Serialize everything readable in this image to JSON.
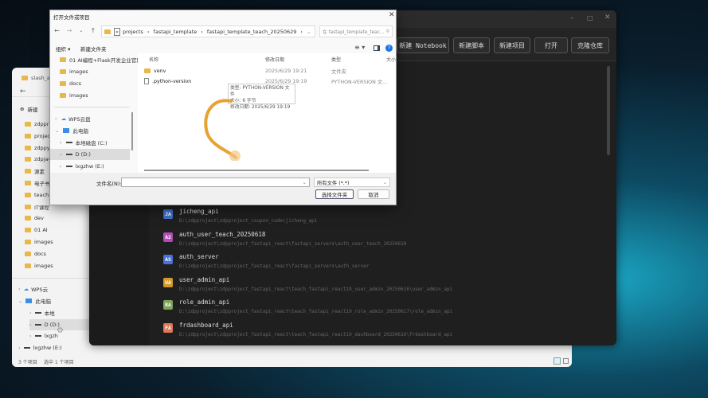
{
  "explorer": {
    "tab": "slash_ad",
    "new_label": "新建",
    "folders": [
      "zdppr",
      "projec",
      "zdppy",
      "zdpjav",
      "源素",
      "电子书",
      "teach",
      "IT课程",
      "dev",
      "01 AI",
      "images",
      "docs",
      "images"
    ],
    "tree": [
      {
        "label": "WPS云",
        "icon": "cloud"
      },
      {
        "label": "此电脑",
        "icon": "pc"
      },
      {
        "label": "本地",
        "icon": "drive"
      },
      {
        "label": "D (D:)",
        "icon": "drive"
      },
      {
        "label": "lxgzh",
        "icon": "drive"
      },
      {
        "label": "lxgzhw (E:)",
        "icon": "drive"
      }
    ],
    "status_items": "3 个项目",
    "status_selected": "选中 1 个项目"
  },
  "app": {
    "toolbar": [
      "新建 Notebook",
      "新建脚本",
      "新建项目",
      "打开",
      "克隆仓库"
    ],
    "projects": [
      {
        "badge": "JA",
        "color": "#3f6fc6",
        "name": "jicheng_api",
        "path": "D:\\zdpproject\\zdpproject_coupon_code\\jicheng_api"
      },
      {
        "badge": "A2",
        "color": "#b24bb5",
        "name": "auth_user_teach_20250618",
        "path": "D:\\zdpproject\\zdpproject_fastapi_react\\fastapi_servers\\auth_user_teach_20250618"
      },
      {
        "badge": "AS",
        "color": "#4a6fd6",
        "name": "auth_server",
        "path": "D:\\zdpproject\\zdpproject_fastapi_react\\fastapi_servers\\auth_server"
      },
      {
        "badge": "UA",
        "color": "#d39a2a",
        "name": "user_admin_api",
        "path": "D:\\zdpproject\\zdpproject_fastapi_react\\teach_fastapi_react19_user_admin_20250616\\user_admin_api"
      },
      {
        "badge": "RA",
        "color": "#7fa35a",
        "name": "role_admin_api",
        "path": "D:\\zdpproject\\zdpproject_fastapi_react\\teach_fastapi_react19_role_admin_20250617\\role_admin_api"
      },
      {
        "badge": "FA",
        "color": "#e0775a",
        "name": "frdashboard_api",
        "path": "D:\\zdpproject\\zdpproject_fastapi_react\\teach_fastapi_react19_dashboard_20250616\\frdashboard_api"
      }
    ]
  },
  "dialog": {
    "title": "打开文件或项目",
    "breadcrumb": [
      "projects",
      "fastapi_template",
      "fastapi_template_teach_20250629"
    ],
    "search_placeholder": "在 fastapi_template_teac...",
    "organize": "组织 ▾",
    "new_folder": "新建文件夹",
    "nav_quick": [
      "01 AI编程+Flask开发企业官网",
      "images",
      "docs",
      "images"
    ],
    "nav_tree": [
      {
        "label": "WPS云盘",
        "icon": "cloud"
      },
      {
        "label": "此电脑",
        "icon": "pc"
      },
      {
        "label": "本地磁盘 (C:)",
        "icon": "drive"
      },
      {
        "label": "D (D:)",
        "icon": "drive"
      },
      {
        "label": "lxgzhw (E:)",
        "icon": "drive"
      }
    ],
    "columns": [
      "名称",
      "修改日期",
      "类型",
      "大小"
    ],
    "files": [
      {
        "name": "venv",
        "date": "2025/6/29 19:21",
        "type": "文件夹",
        "icon": "folder"
      },
      {
        "name": ".python-version",
        "date": "2025/6/29 19:19",
        "type": "PYTHON-VERSION 文...",
        "icon": "file"
      }
    ],
    "tooltip": [
      "类型: PYTHON-VERSION 文件",
      "大小: 6 字节",
      "修改日期: 2025/6/29 19:19"
    ],
    "filename_label": "文件名(N):",
    "filename_value": "",
    "filter": "所有文件 (*.*)",
    "select_folder": "选择文件夹",
    "cancel": "取消"
  }
}
